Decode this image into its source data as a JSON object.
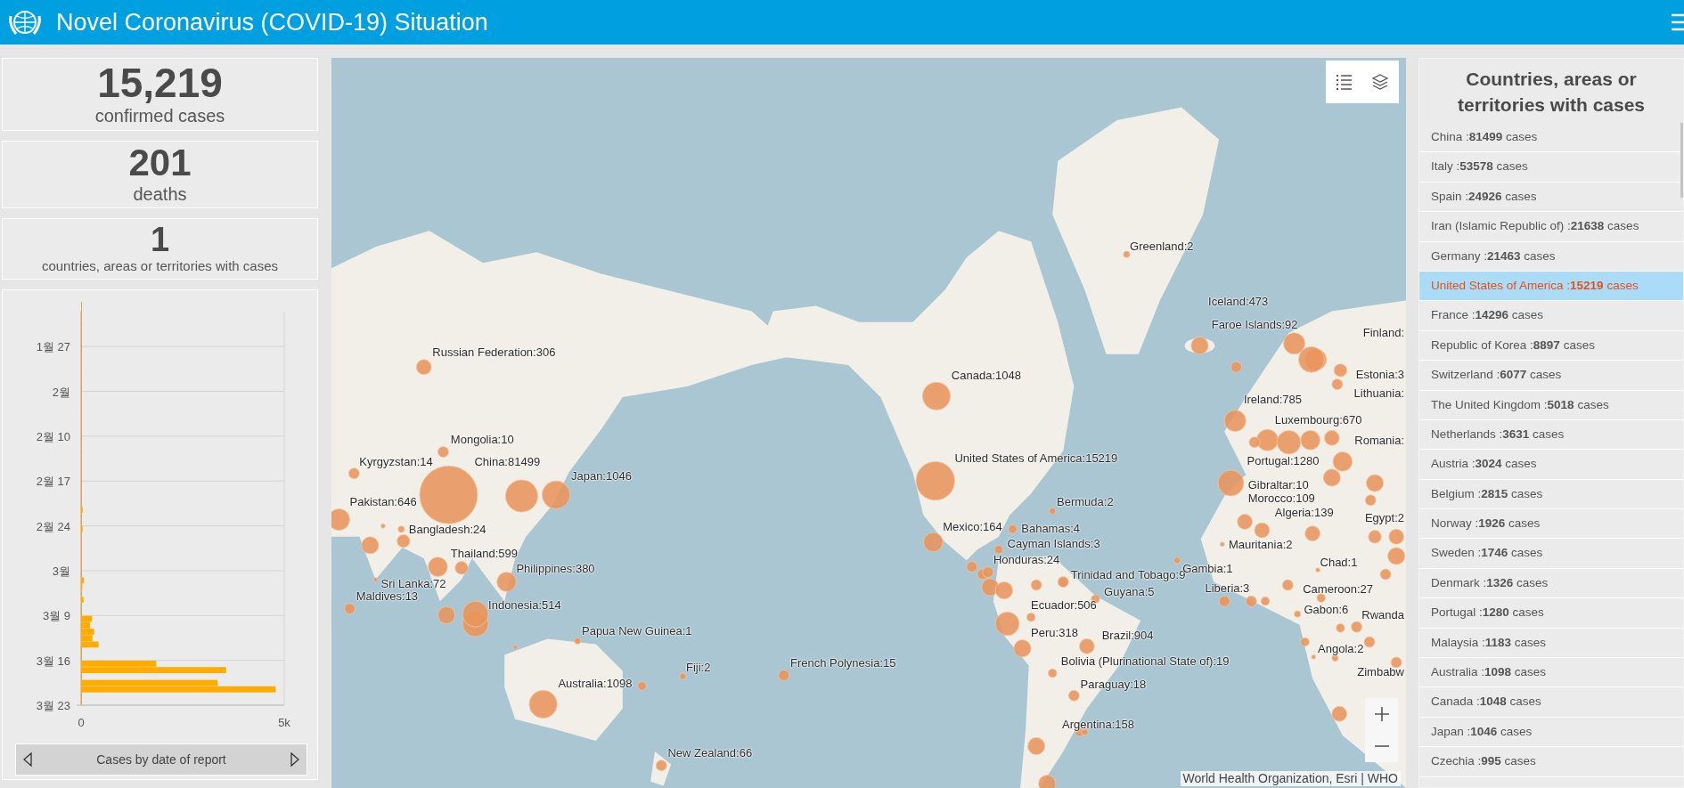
{
  "header": {
    "title": "Novel Coronavirus (COVID-19) Situation"
  },
  "stats": [
    {
      "value": "15,219",
      "label": "confirmed cases"
    },
    {
      "value": "201",
      "label": "deaths"
    },
    {
      "value": "1",
      "label": "countries, areas or territories with cases"
    }
  ],
  "chart": {
    "caption": "Cases by date of report",
    "chart_data": {
      "type": "bar",
      "orientation": "horizontal",
      "categories": [
        null,
        null,
        null,
        null,
        null,
        null,
        "1월 27",
        null,
        null,
        null,
        null,
        null,
        null,
        "2월",
        null,
        null,
        null,
        null,
        null,
        null,
        "2월 10",
        null,
        null,
        null,
        null,
        null,
        null,
        "2월 17",
        null,
        null,
        null,
        null,
        null,
        null,
        "2월 24",
        null,
        null,
        null,
        null,
        null,
        null,
        "3월",
        null,
        null,
        null,
        null,
        null,
        null,
        "3월 9",
        null,
        null,
        null,
        null,
        null,
        null,
        "3월 16",
        null,
        null,
        null,
        null,
        null,
        null,
        "3월 23"
      ],
      "values": [
        0,
        0,
        0,
        0,
        0,
        0,
        0,
        0,
        0,
        0,
        0,
        0,
        0,
        0,
        0,
        0,
        0,
        0,
        0,
        0,
        0,
        0,
        0,
        0,
        0,
        0,
        0,
        0,
        0,
        0,
        0,
        0,
        40,
        0,
        0,
        40,
        0,
        0,
        0,
        0,
        0,
        0,
        0,
        70,
        30,
        0,
        60,
        0,
        0,
        270,
        220,
        320,
        280,
        430,
        0,
        0,
        1850,
        3570,
        0,
        3360,
        4790,
        0,
        0
      ],
      "xlim": [
        0,
        5000
      ],
      "grid": true,
      "xticks": [
        0,
        {
          "value": 5000,
          "label": "5k"
        }
      ]
    }
  },
  "map": {
    "labels": [
      "Russian Federation:306",
      "Mongolia:10",
      "Kyrgyzstan:14",
      "China:81499",
      "Japan:1046",
      "Pakistan:646",
      "Bangladesh:24",
      "Thailand:599",
      "Philippines:380",
      "Sri Lanka:72",
      "Maldives:13",
      "Indonesia:514",
      "Papua New Guinea:1",
      "Fiji:2",
      "Australia:1098",
      "New Zealand:66",
      "French Polynesia:15",
      "Canada:1048",
      "United States of America:15219",
      "Bermuda:2",
      "Mexico:164",
      "Bahamas:4",
      "Cayman Islands:3",
      "Honduras:24",
      "Trinidad and Tobago:9",
      "Guyana:5",
      "Ecuador:506",
      "Peru:318",
      "Brazil:904",
      "Bolivia (Plurinational State of):19",
      "Paraguay:18",
      "Argentina:158",
      "Greenland:2",
      "Iceland:473",
      "Faroe Islands:92",
      "Finland:",
      "Estonia:3",
      "Lithuania:",
      "Ireland:785",
      "Luxembourg:670",
      "Romania:",
      "Portugal:1280",
      "Gibraltar:10",
      "Morocco:109",
      "Algeria:139",
      "Egypt:2",
      "Mauritania:2",
      "Chad:1",
      "Gambia:1",
      "Liberia:3",
      "Cameroon:27",
      "Gabon:6",
      "Rwanda",
      "Angola:2",
      "Zimbabw"
    ],
    "attribution": "World Health Organization, Esri | WHO"
  },
  "country_list": {
    "title": "Countries, areas or territories with cases",
    "items": [
      {
        "text": "China :**81499** cases",
        "selected": false
      },
      {
        "text": "Italy :**53578** cases",
        "selected": false
      },
      {
        "text": "Spain :**24926** cases",
        "selected": false
      },
      {
        "text": "Iran (Islamic Republic of) :**21638** cases",
        "selected": false
      },
      {
        "text": "Germany :**21463** cases",
        "selected": false
      },
      {
        "text": "United States of America :**15219** cases",
        "selected": true
      },
      {
        "text": "France :**14296** cases",
        "selected": false
      },
      {
        "text": "Republic of Korea :**8897** cases",
        "selected": false
      },
      {
        "text": "Switzerland :**6077** cases",
        "selected": false
      },
      {
        "text": "The United Kingdom :**5018** cases",
        "selected": false
      },
      {
        "text": "Netherlands :**3631** cases",
        "selected": false
      },
      {
        "text": "Austria :**3024** cases",
        "selected": false
      },
      {
        "text": "Belgium :**2815** cases",
        "selected": false
      },
      {
        "text": "Norway :**1926** cases",
        "selected": false
      },
      {
        "text": "Sweden :**1746** cases",
        "selected": false
      },
      {
        "text": "Denmark :**1326** cases",
        "selected": false
      },
      {
        "text": "Portugal :**1280** cases",
        "selected": false
      },
      {
        "text": "Malaysia :**1183** cases",
        "selected": false
      },
      {
        "text": "Australia :**1098** cases",
        "selected": false
      },
      {
        "text": "Canada :**1048** cases",
        "selected": false
      },
      {
        "text": "Japan :**1046** cases",
        "selected": false
      },
      {
        "text": "Czechia :**995** cases",
        "selected": false
      }
    ]
  }
}
